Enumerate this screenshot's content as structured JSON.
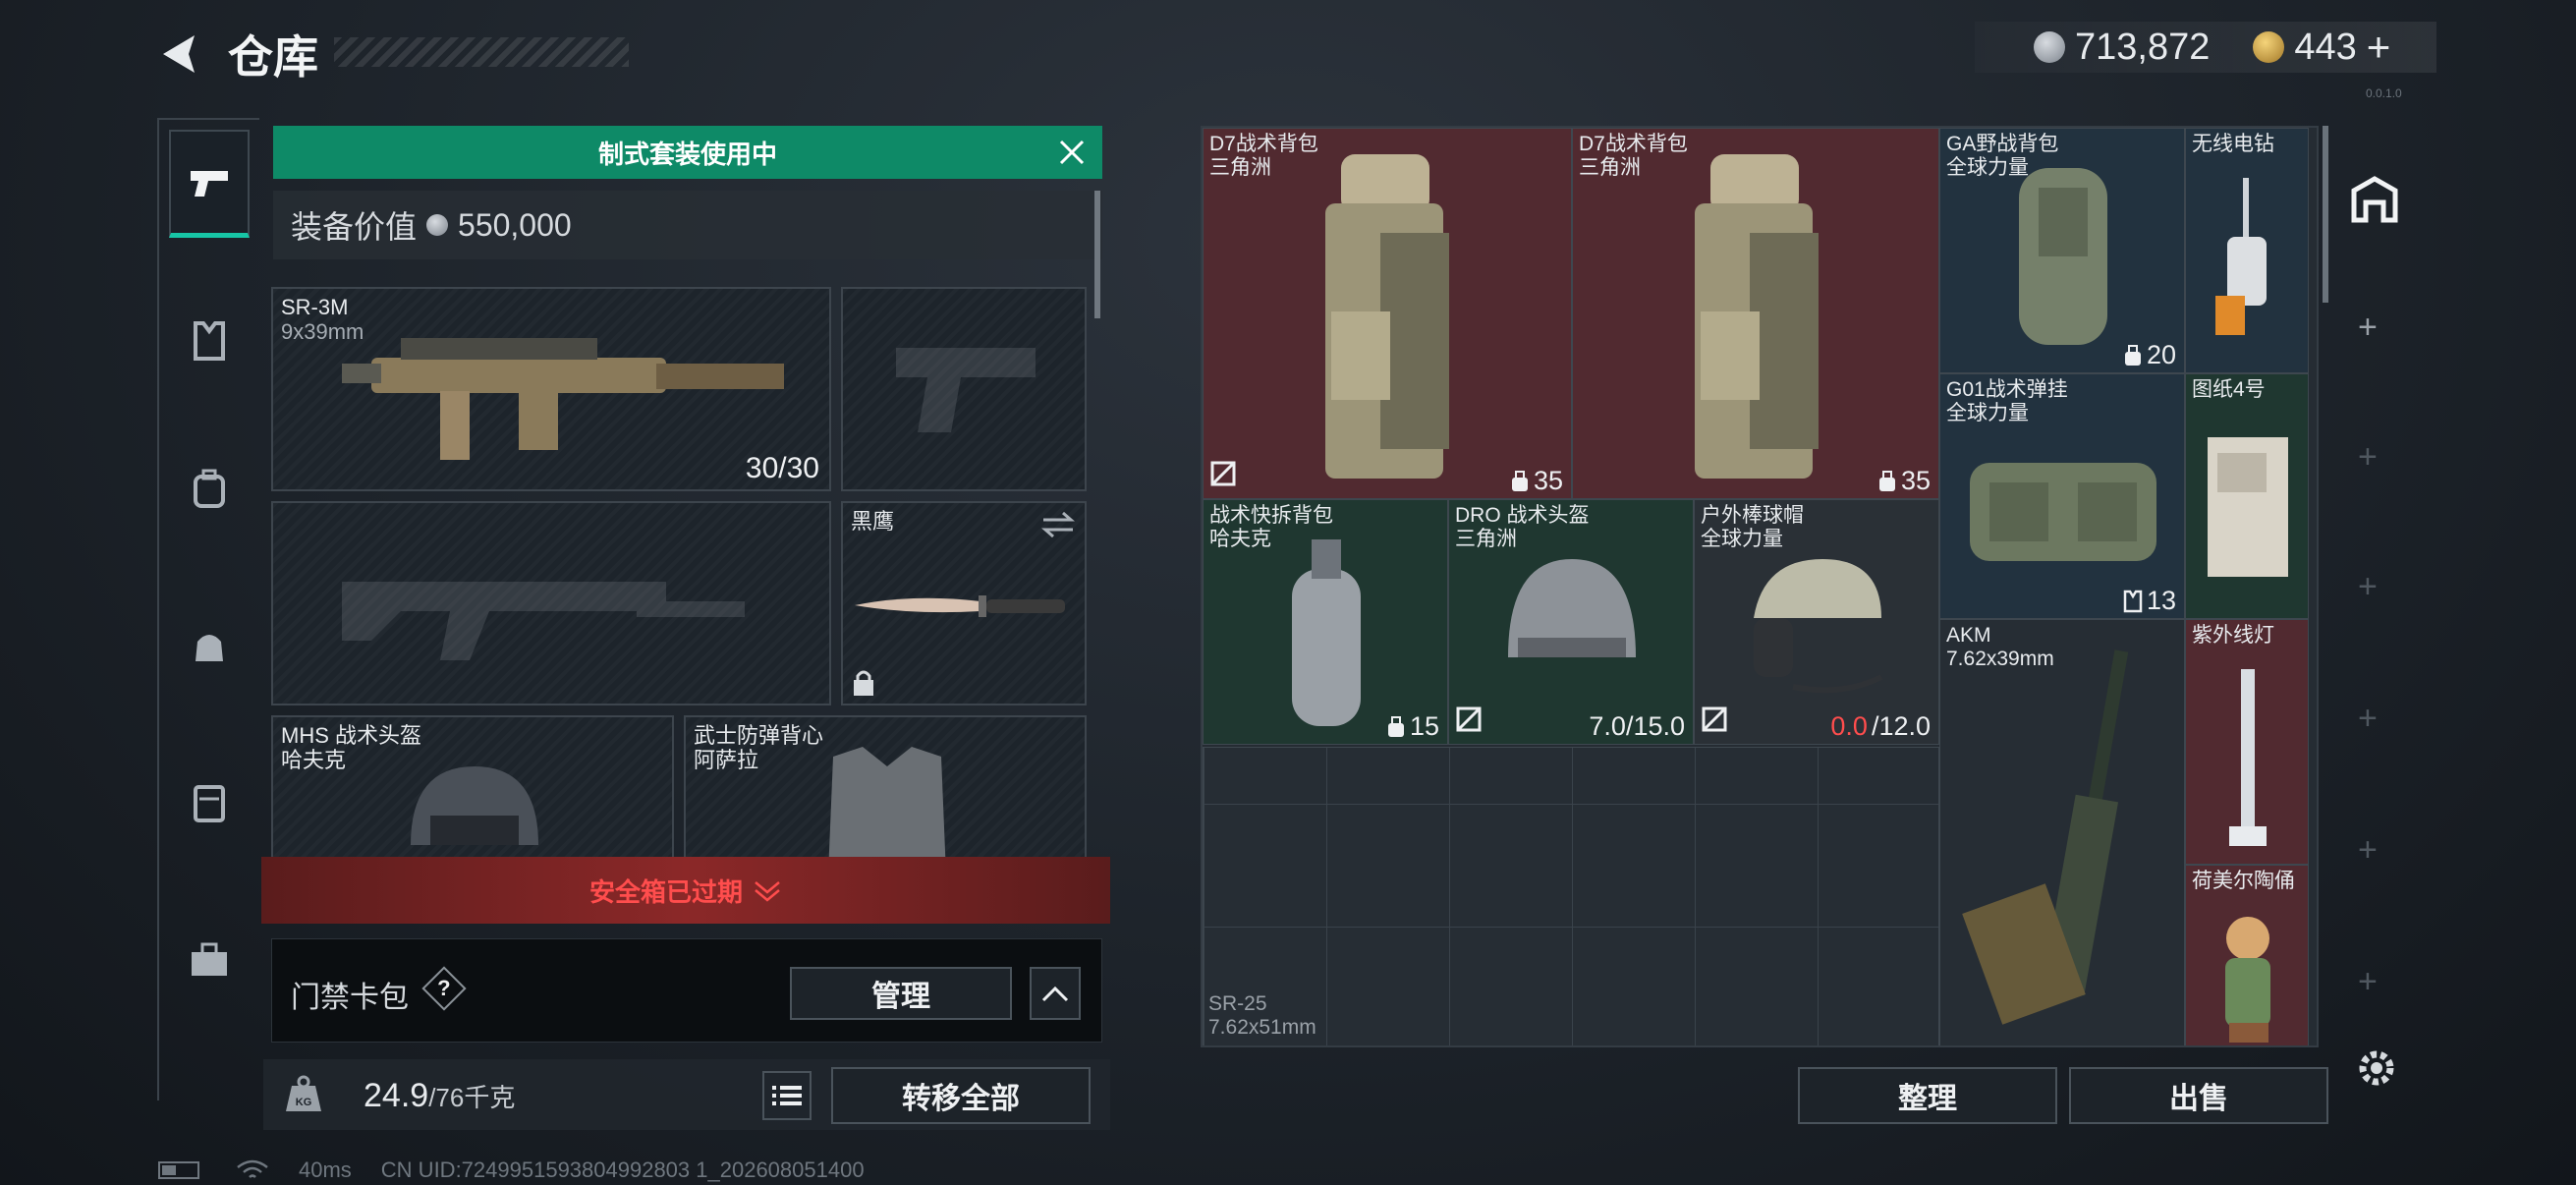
{
  "header": {
    "title": "仓库",
    "currency": [
      {
        "icon": "silver-coin-icon",
        "value": "713,872"
      },
      {
        "icon": "gold-coin-icon",
        "value": "443"
      }
    ],
    "add_label": "+",
    "version": "0.0.1.0"
  },
  "nav": [
    "pistol-icon",
    "armor-icon",
    "backpack-icon",
    "pouch-icon",
    "case-icon",
    "toolbox-icon"
  ],
  "loadout": {
    "banner": "制式套装使用中",
    "value_label": "装备价值",
    "value": "550,000",
    "slots": {
      "primary": {
        "name": "SR-3M",
        "sub": "9x39mm",
        "count": "30/30"
      },
      "melee": {
        "name": "黑鹰"
      },
      "helmet": {
        "name": "MHS 战术头盔",
        "sub": "哈夫克"
      },
      "armor": {
        "name": "武士防弹背心",
        "sub": "阿萨拉"
      }
    },
    "expired": "安全箱已过期",
    "keycard_label": "门禁卡包",
    "help": "?",
    "manage_label": "管理",
    "weight": "24.9",
    "weight_max": "/76千克",
    "weight_icon": "KG",
    "transfer_label": "转移全部"
  },
  "stash": {
    "items": [
      {
        "name": "D7战术背包",
        "sub": "三角洲",
        "badge": "35"
      },
      {
        "name": "D7战术背包",
        "sub": "三角洲",
        "badge": "35"
      },
      {
        "name": "GA野战背包",
        "sub": "全球力量",
        "badge": "20"
      },
      {
        "name": "无线电钻"
      },
      {
        "name": "G01战术弹挂",
        "sub": "全球力量",
        "badge": "13"
      },
      {
        "name": "图纸4号"
      },
      {
        "name": "战术快拆背包",
        "sub": "哈夫克",
        "badge": "15"
      },
      {
        "name": "DRO 战术头盔",
        "sub": "三角洲",
        "dur": "7.0/15.0"
      },
      {
        "name": "户外棒球帽",
        "sub": "全球力量",
        "dur_low": "0.0",
        "dur_max": "/12.0"
      },
      {
        "name": "AKM",
        "sub": "7.62x39mm"
      },
      {
        "name": "紫外线灯"
      },
      {
        "name": "荷美尔陶俑"
      },
      {
        "name": "SR-25",
        "sub": "7.62x51mm"
      }
    ],
    "sort_label": "整理",
    "sell_label": "出售"
  },
  "status": {
    "ping": "40ms",
    "uid": "CN UID:7249951593804992803 1_202608051400"
  },
  "colors": {
    "accent": "#17c6a6",
    "banner": "#0e8a67",
    "expired": "#ff4d4d"
  }
}
